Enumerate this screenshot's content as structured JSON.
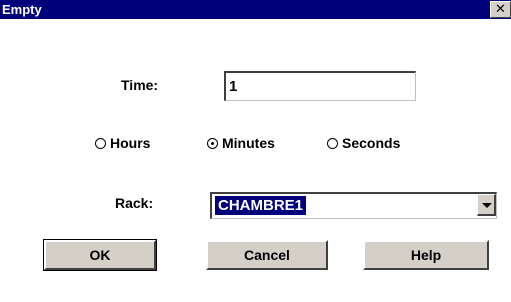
{
  "window": {
    "title": "Empty",
    "close_glyph": "✕"
  },
  "time": {
    "label": "Time:",
    "value": "1"
  },
  "units": {
    "options": [
      {
        "label": "Hours",
        "checked": false
      },
      {
        "label": "Minutes",
        "checked": true
      },
      {
        "label": "Seconds",
        "checked": false
      }
    ]
  },
  "rack": {
    "label": "Rack:",
    "selected": "CHAMBRE1"
  },
  "buttons": {
    "ok": "OK",
    "cancel": "Cancel",
    "help": "Help"
  },
  "colors": {
    "titlebar": "#00007a",
    "face": "#d4d0c8",
    "selection": "#00007a"
  }
}
